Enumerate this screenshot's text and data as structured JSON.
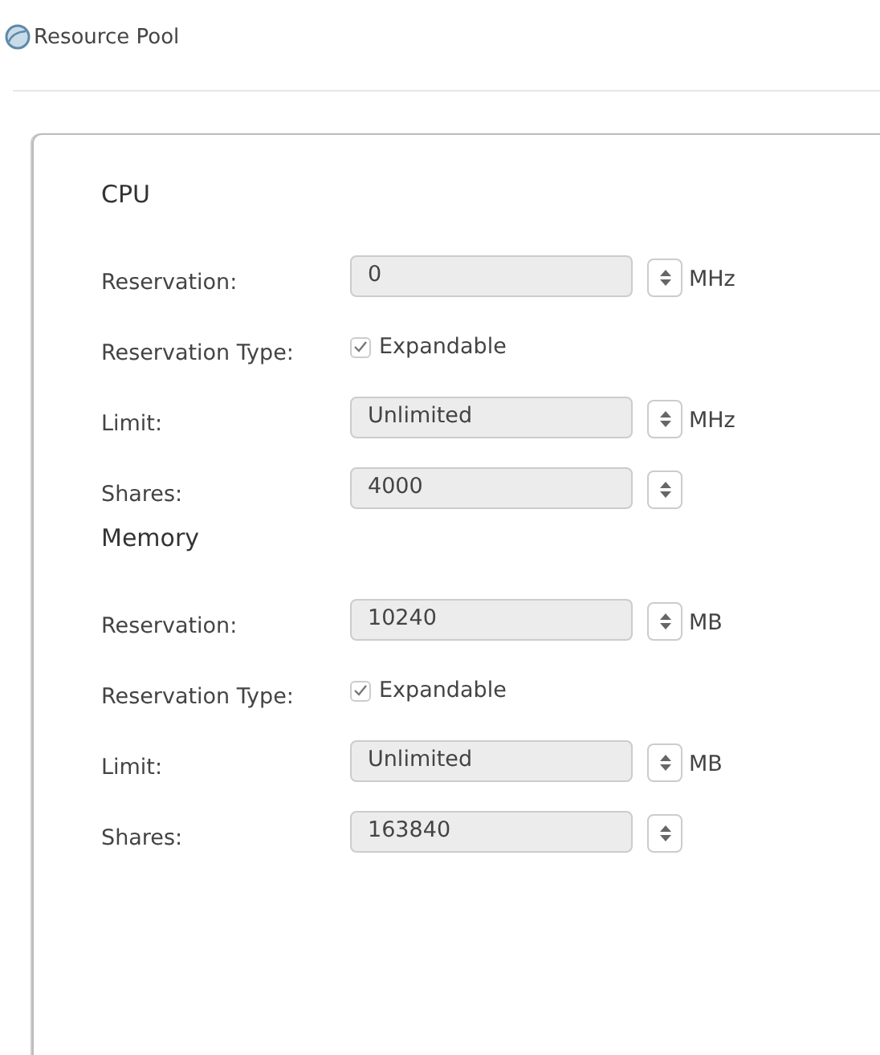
{
  "header": {
    "title": "Resource Pool"
  },
  "sections": [
    {
      "title": "CPU",
      "rows": [
        {
          "kind": "field",
          "label": "Reservation:",
          "value": "0",
          "unit": "MHz"
        },
        {
          "kind": "checkbox",
          "label": "Reservation Type:",
          "option": "Expandable",
          "checked": true
        },
        {
          "kind": "field",
          "label": "Limit:",
          "value": "Unlimited",
          "unit": "MHz"
        },
        {
          "kind": "field",
          "label": "Shares:",
          "value": "4000"
        }
      ]
    },
    {
      "title": "Memory",
      "rows": [
        {
          "kind": "field",
          "label": "Reservation:",
          "value": "10240",
          "unit": "MB"
        },
        {
          "kind": "checkbox",
          "label": "Reservation Type:",
          "option": "Expandable",
          "checked": true
        },
        {
          "kind": "field",
          "label": "Limit:",
          "value": "Unlimited",
          "unit": "MB"
        },
        {
          "kind": "field",
          "label": "Shares:",
          "value": "163840"
        }
      ]
    }
  ]
}
